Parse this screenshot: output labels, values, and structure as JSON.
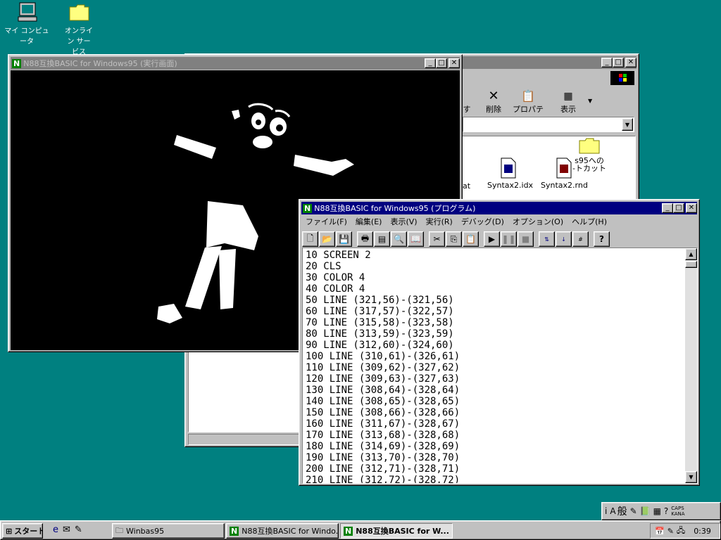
{
  "desktop": {
    "icons": [
      {
        "label": "マイ コンピュータ",
        "icon": "computer-icon"
      },
      {
        "label": "オンライン サービス",
        "icon": "folder-icon"
      }
    ]
  },
  "explorer": {
    "toolbar": {
      "delete_label": "削除",
      "properties_label": "プロパティ",
      "view_label": "表示",
      "partial_label": "す"
    },
    "files": [
      {
        "name": "dat",
        "icon": "file-icon"
      },
      {
        "name": "Syntax2.idx",
        "icon": "document-icon"
      },
      {
        "name": "Syntax2.rnd",
        "icon": "document-icon"
      },
      {
        "name": "s95への\n-トカット",
        "icon": "shortcut-folder-icon"
      }
    ]
  },
  "run_window": {
    "title": "N88互換BASIC for Windows95 (実行画面)"
  },
  "program_window": {
    "title": "N88互換BASIC for Windows95 (プログラム)",
    "menu": [
      "ファイル(F)",
      "編集(E)",
      "表示(V)",
      "実行(R)",
      "デバッグ(D)",
      "オプション(O)",
      "ヘルプ(H)"
    ],
    "code_lines": [
      "10 SCREEN 2",
      "20 CLS",
      "30 COLOR 4",
      "40 COLOR 4",
      "50 LINE (321,56)-(321,56)",
      "60 LINE (317,57)-(322,57)",
      "70 LINE (315,58)-(323,58)",
      "80 LINE (313,59)-(323,59)",
      "90 LINE (312,60)-(324,60)",
      "100 LINE (310,61)-(326,61)",
      "110 LINE (309,62)-(327,62)",
      "120 LINE (309,63)-(327,63)",
      "130 LINE (308,64)-(328,64)",
      "140 LINE (308,65)-(328,65)",
      "150 LINE (308,66)-(328,66)",
      "160 LINE (311,67)-(328,67)",
      "170 LINE (313,68)-(328,68)",
      "180 LINE (314,69)-(328,69)",
      "190 LINE (313,70)-(328,70)",
      "200 LINE (312,71)-(328,71)",
      "210 LINE (312,72)-(328,72)"
    ]
  },
  "tray_toolbar": {
    "ime_label": "般",
    "caps": "CAPS",
    "kana": "KANA"
  },
  "taskbar": {
    "start_label": "スタート",
    "tasks": [
      {
        "label": "Winbas95",
        "active": false
      },
      {
        "label": "N88互換BASIC for Windo...",
        "active": false
      },
      {
        "label": "N88互換BASIC for W...",
        "active": true
      }
    ],
    "clock": "0:39"
  },
  "colors": {
    "desktop": "#008080",
    "active_title": "#000080",
    "inactive_title": "#808080",
    "face": "#c0c0c0"
  }
}
